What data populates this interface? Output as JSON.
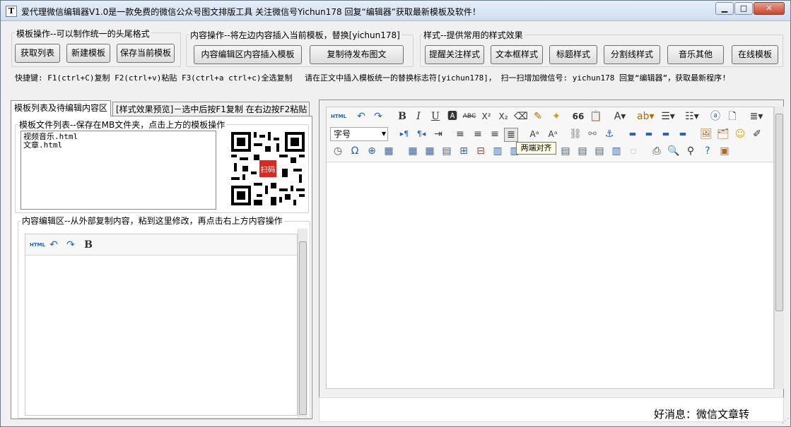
{
  "window": {
    "icon": "T",
    "title": "爱代理微信编辑器V1.0是一款免费的微信公众号图文排版工具 关注微信号Yichun178 回复“编辑器”获取最新模板及软件！",
    "min": "▁",
    "max": "□",
    "close": "✕"
  },
  "template_ops": {
    "label": "模板操作--可以制作统一的头尾格式",
    "get_list": "获取列表",
    "new_template": "新建模板",
    "save_template": "保存当前模板"
  },
  "content_ops": {
    "label": "内容操作--将左边内容插入当前模板，替换[yichun178]",
    "insert": "内容编辑区内容插入模板",
    "copy_publish": "复制待发布图文"
  },
  "style_ops": {
    "label": "样式--提供常用的样式效果",
    "buttons": [
      "提醒关注样式",
      "文本框样式",
      "标题样式",
      "分割线样式",
      "音乐其他",
      "在线模板"
    ]
  },
  "hints": {
    "shortcuts": "快捷键: F1(ctrl+C)复制  F2(ctrl+v)粘贴 F3(ctrl+a ctrl+c)全选复制",
    "notice": "请在正文中插入模板统一的替换标志符[yichun178]， 扫一扫增加微信号: yichun178 回复“编辑器”，获取最新程序!"
  },
  "tabs": {
    "tab1": "模板列表及待编辑内容区",
    "tab2": "[样式效果预览]－选中后按F1复制 在右边按F2粘贴"
  },
  "template_list": {
    "label": "模板文件列表--保存在MB文件夹，点击上方的模板操作",
    "items": [
      "视频音乐.html",
      "文章.html"
    ],
    "qr_badge": "扫码"
  },
  "content_area": {
    "label": "内容编辑区--从外部复制内容，粘到这里修改，再点击右上方内容操作",
    "toolbar": {
      "html": "HTML",
      "bold": "B"
    }
  },
  "main_editor": {
    "font_size": "字号",
    "tooltip": "两端对齐",
    "toolbar": {
      "html": "HTML",
      "bold": "B",
      "italic": "I",
      "underline": "U",
      "sup": "X²",
      "sub": "X₂",
      "quote": "66"
    }
  },
  "status": {
    "news": "好消息：微信文章转"
  }
}
